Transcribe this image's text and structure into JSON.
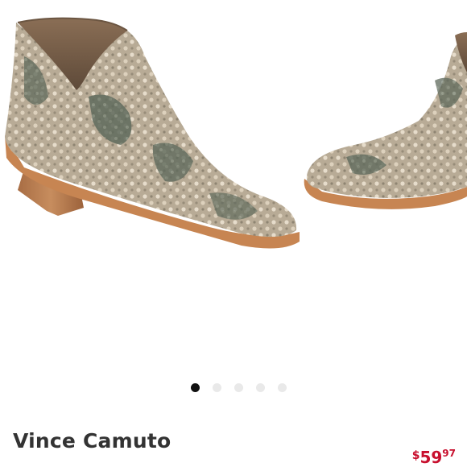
{
  "product": {
    "brand": "Vince Camuto",
    "price": {
      "currency_symbol": "$",
      "whole": "59",
      "cents": "97"
    },
    "image_icon": "snakeskin-ankle-bootie-photo"
  },
  "carousel": {
    "total_slides": 5,
    "active_index": 0
  },
  "colors": {
    "price": "#c8102e",
    "brand_text": "#333333",
    "active_dot": "#111111",
    "inactive_dot": "#e9e9e9"
  }
}
